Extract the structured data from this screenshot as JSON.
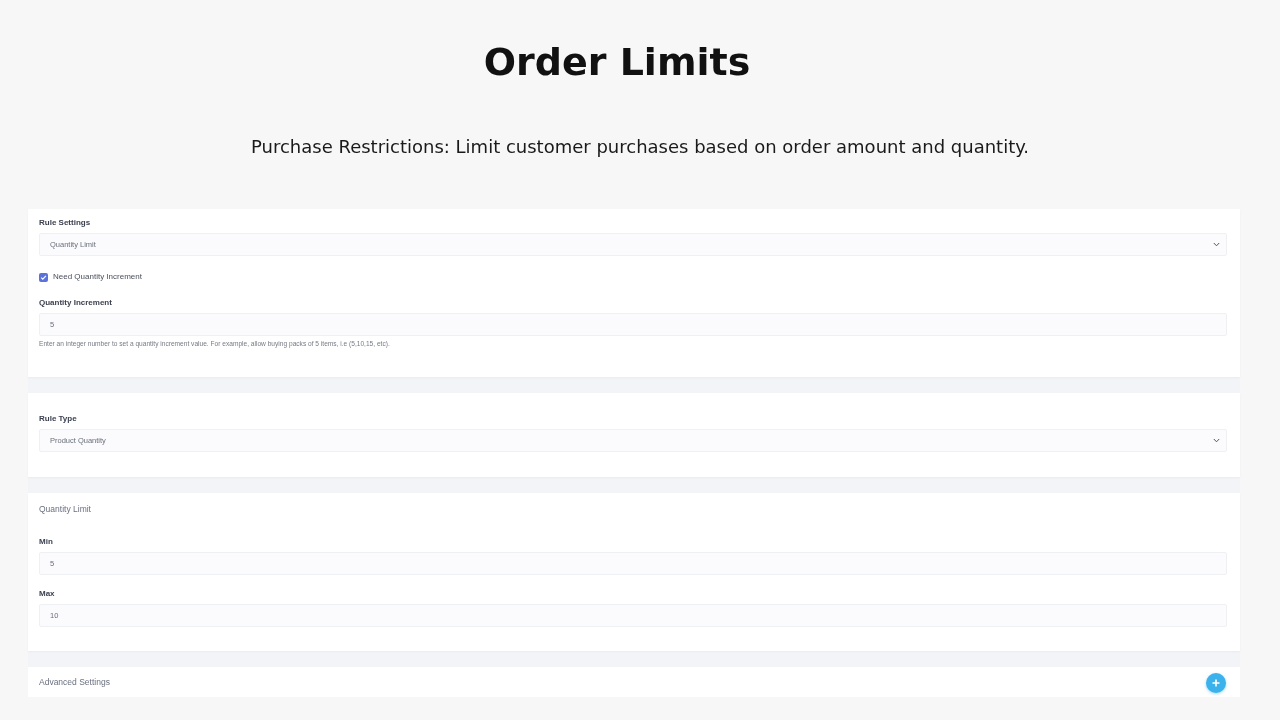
{
  "title": "Order Limits",
  "subtitle": "Purchase Restrictions: Limit customer purchases based on order amount and quantity.",
  "sections": [
    {
      "fields": [
        {
          "kind": "select",
          "label": "Rule Settings",
          "value": "Quantity Limit"
        },
        {
          "kind": "checkbox",
          "label": "Need Quantity Increment",
          "checked": true
        },
        {
          "kind": "input",
          "label": "Quantity Increment",
          "value": "5",
          "help": "Enter an integer number to set a quantity increment value. For example, allow buying packs of 5 items, i.e (5,10,15, etc)."
        }
      ]
    },
    {
      "fields": [
        {
          "kind": "select",
          "label": "Rule Type",
          "value": "Product Quantity"
        }
      ]
    },
    {
      "heading": "Quantity Limit",
      "fields": [
        {
          "kind": "input",
          "label": "Min",
          "value": "5"
        },
        {
          "kind": "input",
          "label": "Max",
          "value": "10"
        }
      ]
    }
  ],
  "advanced_settings": {
    "title": "Advanced Settings",
    "expanded": false
  }
}
